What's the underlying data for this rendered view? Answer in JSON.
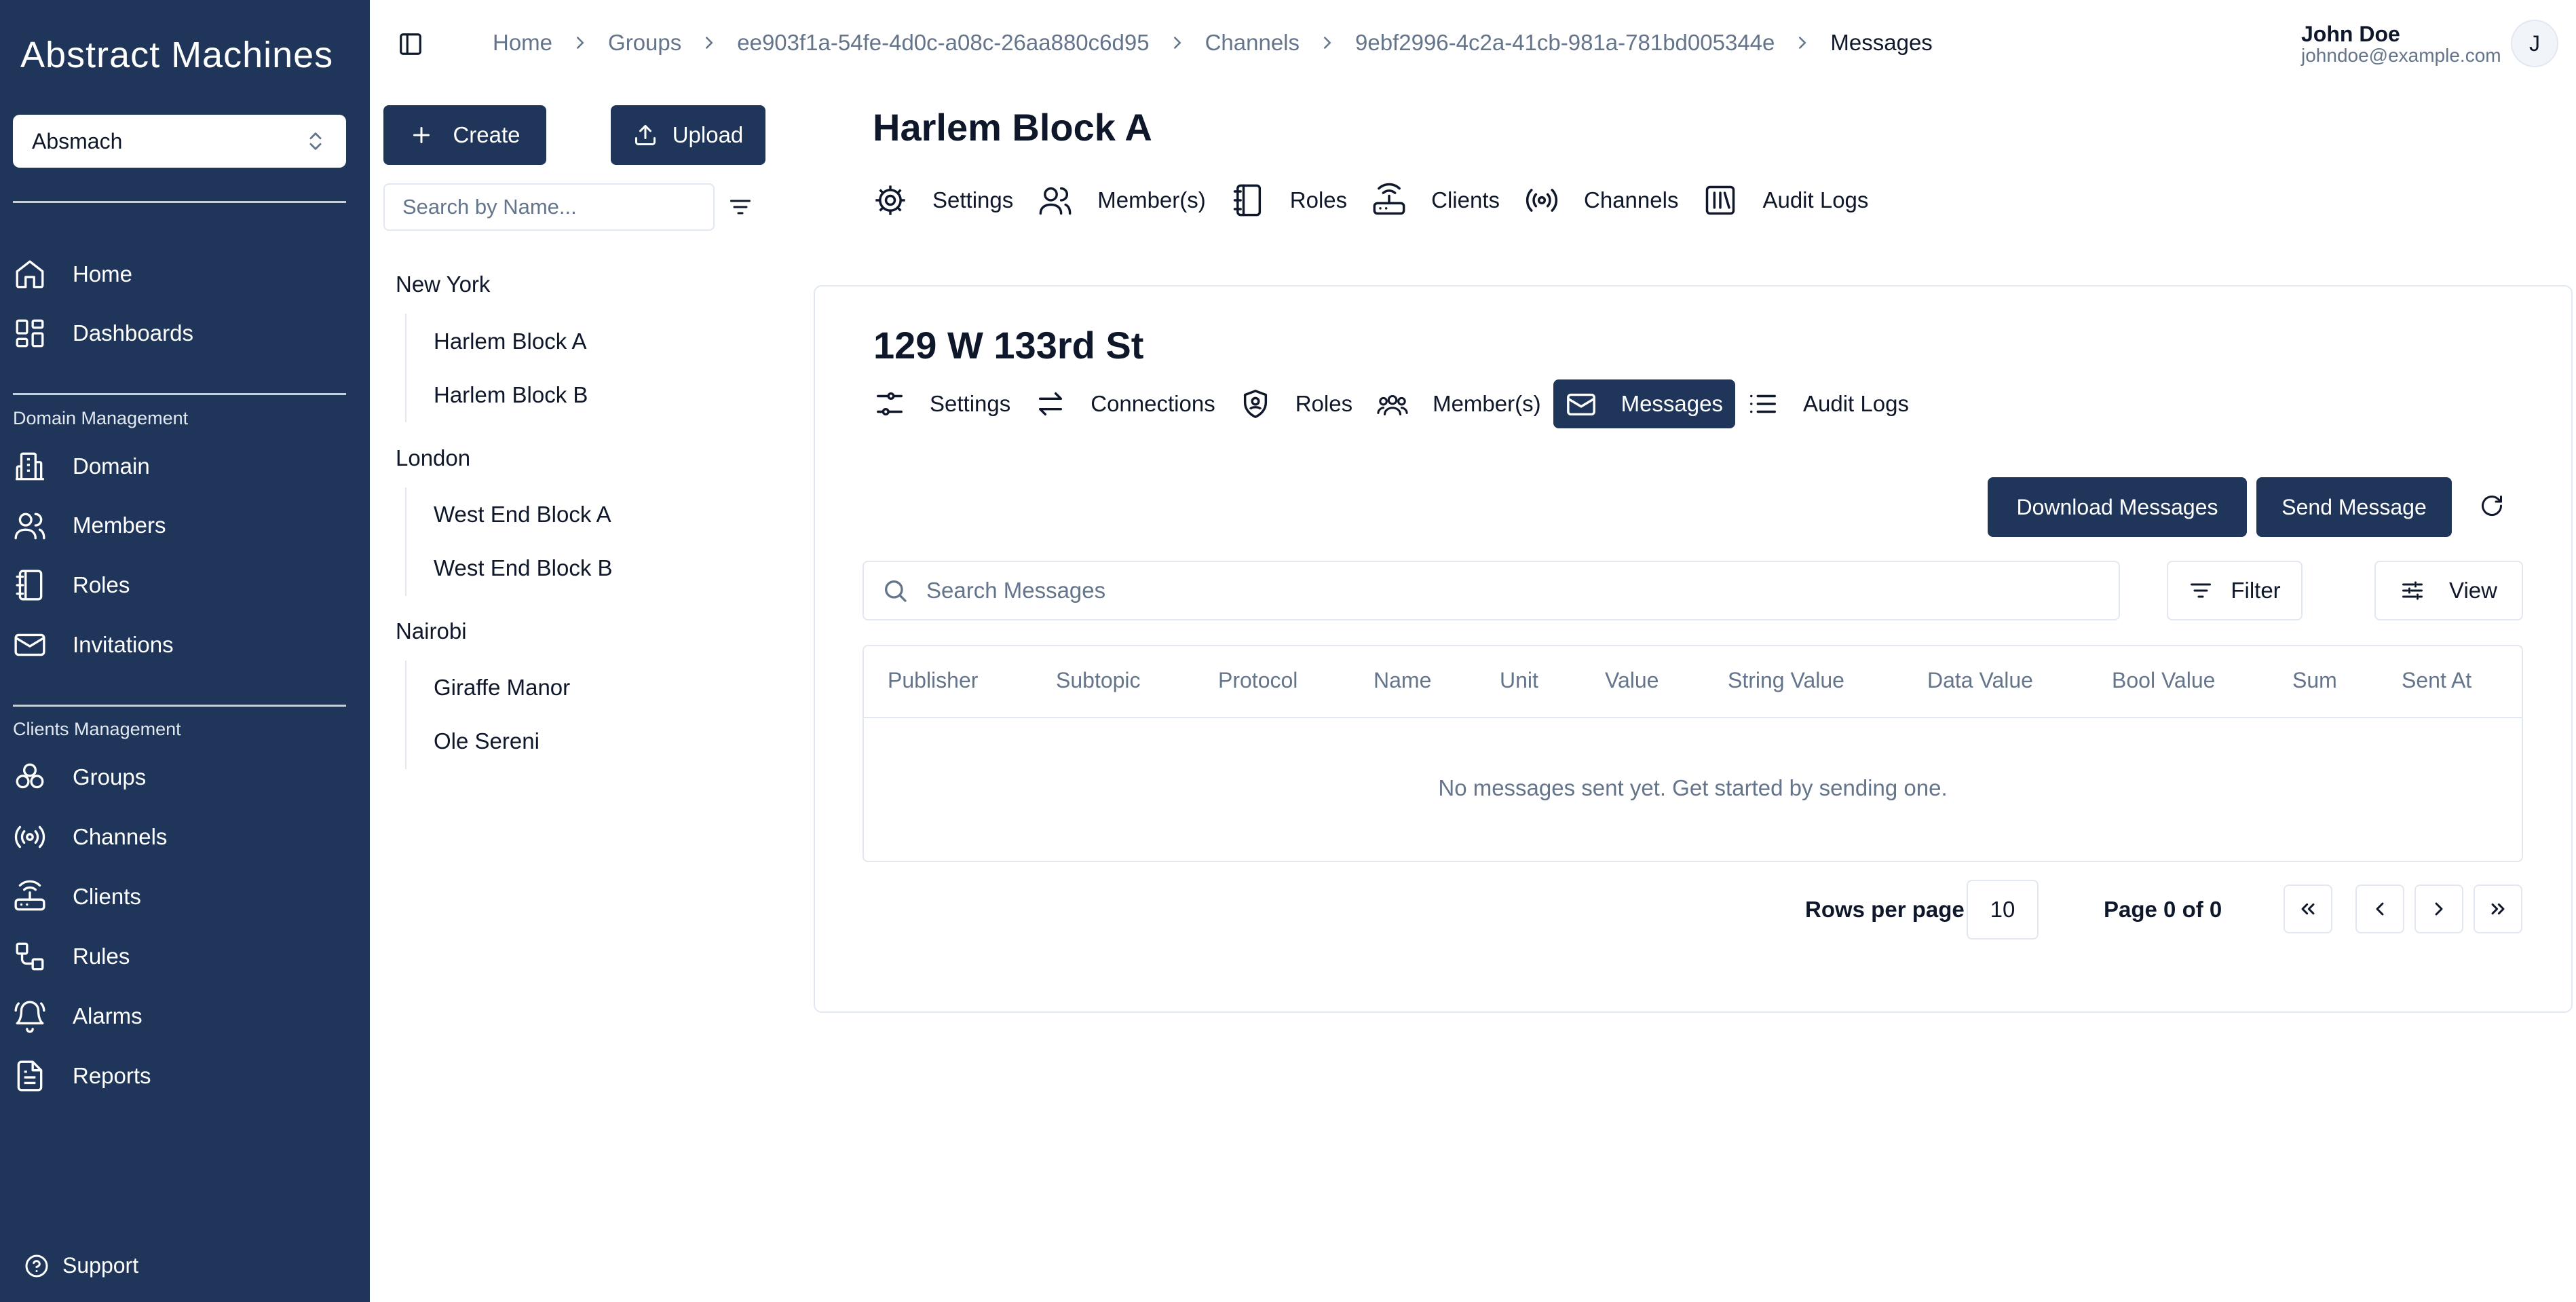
{
  "sidebar": {
    "logo": "Abstract Machines",
    "workspace": "Absmach",
    "items_main": [
      {
        "label": "Home",
        "icon": "home-icon"
      },
      {
        "label": "Dashboards",
        "icon": "dashboards-icon"
      }
    ],
    "domain_heading": "Domain Management",
    "items_domain": [
      {
        "label": "Domain",
        "icon": "domain-icon"
      },
      {
        "label": "Members",
        "icon": "members-icon"
      },
      {
        "label": "Roles",
        "icon": "roles-icon"
      },
      {
        "label": "Invitations",
        "icon": "mail-icon"
      }
    ],
    "clients_heading": "Clients Management",
    "items_clients": [
      {
        "label": "Groups",
        "icon": "groups-icon"
      },
      {
        "label": "Channels",
        "icon": "channels-icon"
      },
      {
        "label": "Clients",
        "icon": "clients-icon"
      },
      {
        "label": "Rules",
        "icon": "rules-icon"
      },
      {
        "label": "Alarms",
        "icon": "bell-icon"
      },
      {
        "label": "Reports",
        "icon": "reports-icon"
      }
    ],
    "support": "Support"
  },
  "breadcrumb": [
    "Home",
    "Groups",
    "ee903f1a-54fe-4d0c-a08c-26aa880c6d95",
    "Channels",
    "9ebf2996-4c2a-41cb-981a-781bd005344e",
    "Messages"
  ],
  "user": {
    "name": "John Doe",
    "email": "johndoe@example.com",
    "initial": "J"
  },
  "tree_panel": {
    "create": "Create",
    "upload": "Upload",
    "search_placeholder": "Search by Name...",
    "groups": [
      {
        "name": "New York",
        "children": [
          "Harlem Block A",
          "Harlem Block B"
        ]
      },
      {
        "name": "London",
        "children": [
          "West End Block A",
          "West End Block B"
        ]
      },
      {
        "name": "Nairobi",
        "children": [
          "Giraffe Manor",
          "Ole Sereni"
        ]
      }
    ]
  },
  "group": {
    "title": "Harlem Block A",
    "tabs": [
      "Settings",
      "Member(s)",
      "Roles",
      "Clients",
      "Channels",
      "Audit Logs"
    ]
  },
  "channel": {
    "title": "129 W 133rd St",
    "tabs": [
      "Settings",
      "Connections",
      "Roles",
      "Member(s)",
      "Messages",
      "Audit Logs"
    ],
    "active_tab": "Messages"
  },
  "messages": {
    "download_button": "Download Messages",
    "send_button": "Send Message",
    "search_placeholder": "Search Messages",
    "filter_button": "Filter",
    "view_button": "View",
    "columns": [
      "Publisher",
      "Subtopic",
      "Protocol",
      "Name",
      "Unit",
      "Value",
      "String Value",
      "Data Value",
      "Bool Value",
      "Sum",
      "Sent At"
    ],
    "empty_text": "No messages sent yet. Get started by sending one.",
    "rows_per_page_label": "Rows per page",
    "rows_per_page": "10",
    "page_info": "Page 0 of 0"
  },
  "colors": {
    "sidebar": "#1f3559",
    "primary": "#1f3559",
    "border": "#e2e8f0",
    "muted": "#64748b"
  }
}
